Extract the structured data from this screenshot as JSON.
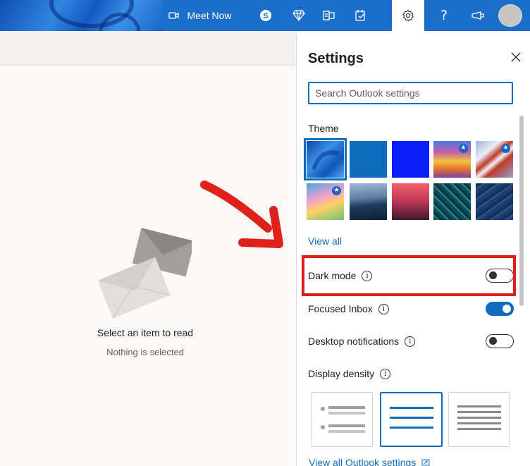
{
  "header": {
    "meet_now_label": "Meet Now",
    "icons": [
      "video-icon",
      "skype-icon",
      "diamond-icon",
      "office-icon",
      "todo-icon",
      "gear-icon",
      "help-icon",
      "feedback-icon"
    ]
  },
  "reading_pane": {
    "empty_title": "Select an item to read",
    "empty_subtitle": "Nothing is selected"
  },
  "settings": {
    "title": "Settings",
    "search_placeholder": "Search Outlook settings",
    "theme_label": "Theme",
    "themes": [
      {
        "name": "Blue swirl",
        "selected": true,
        "premium": false
      },
      {
        "name": "Blue",
        "selected": false,
        "premium": false
      },
      {
        "name": "Bright blue",
        "selected": false,
        "premium": false
      },
      {
        "name": "Rainbow",
        "selected": false,
        "premium": true
      },
      {
        "name": "Flag",
        "selected": false,
        "premium": true
      },
      {
        "name": "Unicorn",
        "selected": false,
        "premium": true
      },
      {
        "name": "Mountain",
        "selected": false,
        "premium": false
      },
      {
        "name": "Palm sunset",
        "selected": false,
        "premium": false
      },
      {
        "name": "Circuit",
        "selected": false,
        "premium": false
      },
      {
        "name": "Navigation",
        "selected": false,
        "premium": false
      }
    ],
    "view_all_label": "View all",
    "dark_mode_label": "Dark mode",
    "dark_mode_on": false,
    "focused_inbox_label": "Focused Inbox",
    "focused_inbox_on": true,
    "desktop_notifications_label": "Desktop notifications",
    "desktop_notifications_on": false,
    "display_density_label": "Display density",
    "display_density_options": [
      "Full",
      "Medium",
      "Compact"
    ],
    "display_density_selected": "Medium",
    "view_all_settings_label": "View all Outlook settings"
  },
  "colors": {
    "accent": "#0f6cbd",
    "header": "#1b6fc9",
    "annotation": "#e0201b"
  }
}
